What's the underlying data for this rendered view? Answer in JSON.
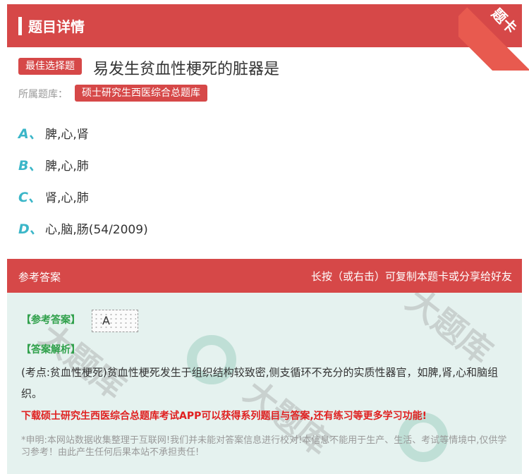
{
  "header": {
    "title": "题目详情",
    "corner_label": "题卡"
  },
  "question": {
    "type_badge": "最佳选择题",
    "text": "易发生贫血性梗死的脏器是",
    "bank_label": "所属题库：",
    "bank_name": "硕士研究生西医综合总题库"
  },
  "options": [
    {
      "letter": "A、",
      "text": "脾,心,肾"
    },
    {
      "letter": "B、",
      "text": "脾,心,肺"
    },
    {
      "letter": "C、",
      "text": "肾,心,肺"
    },
    {
      "letter": "D、",
      "text": "心,脑,肠(54/2009)"
    }
  ],
  "answer": {
    "header_left": "参考答案",
    "header_right": "长按（或右击）可复制本题卡或分享给好友",
    "ref_label": "【参考答案】",
    "ref_value": "A",
    "explanation_label": "【答案解析】",
    "explanation": "(考点:贫血性梗死)贫血性梗死发生于组织结构较致密,侧支循环不充分的实质性器官，如脾,肾,心和脑组织。",
    "promo": "下载硕士研究生西医综合总题库考试APP可以获得系列题目与答案,还有练习等更多学习功能!",
    "disclaimer": "*申明:本网站数据收集整理于互联网!我们并未能对答案信息进行校对!本信息不能用于生产、生活、考试等情境中,仅供学习参考！由此产生任何后果本站不承担责任!"
  },
  "watermark": {
    "text": "大题库"
  },
  "colors": {
    "accent": "#d64848",
    "option_letter": "#3bb6c8",
    "answer_bg": "#e5f2ef",
    "green_label": "#2fa04a",
    "promo": "#e02020"
  }
}
